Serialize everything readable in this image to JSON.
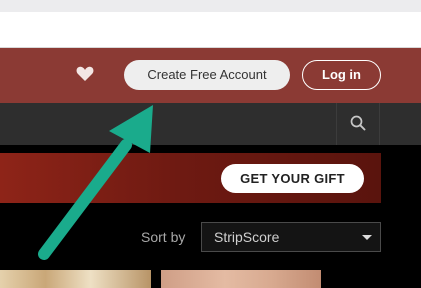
{
  "header": {
    "favorites_icon": "heart-icon",
    "create_account_label": "Create Free Account",
    "login_label": "Log in"
  },
  "nav": {
    "search_icon": "search-icon"
  },
  "promo": {
    "gift_label": "GET YOUR GIFT"
  },
  "sort": {
    "label": "Sort by",
    "selected": "StripScore"
  },
  "annotation": {
    "arrow_color": "#1aab8c"
  },
  "colors": {
    "header_bg": "#8b3a34",
    "nav_bg": "#2e2e2e",
    "banner_bg": "#7a1e14",
    "page_bg": "#000000"
  }
}
